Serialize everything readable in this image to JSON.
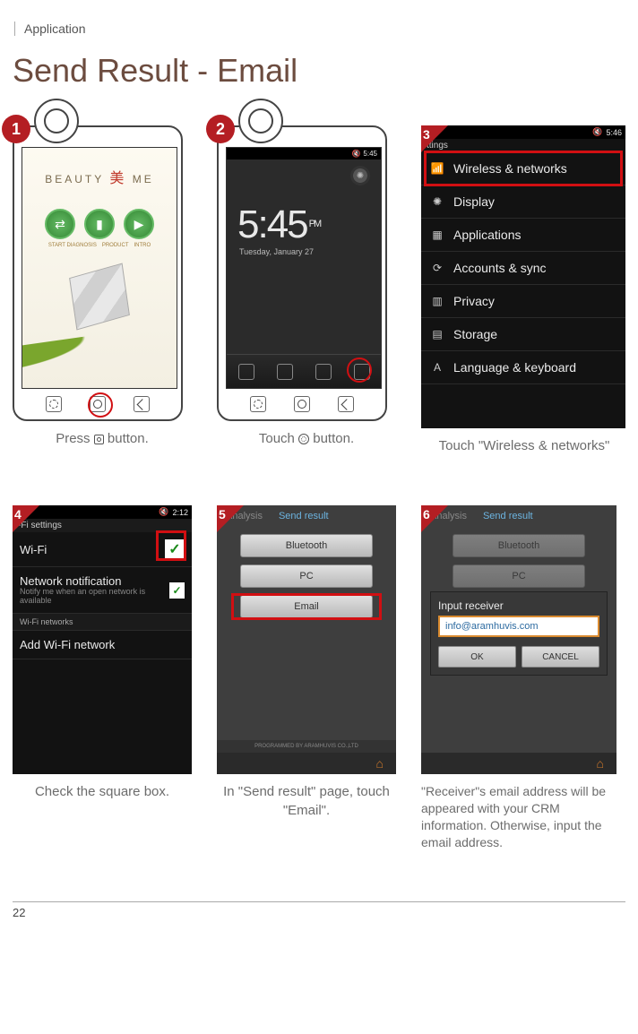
{
  "breadcrumb": "Application",
  "title": "Send Result - Email",
  "page_number": "22",
  "badges": {
    "s1": "1",
    "s2": "2",
    "s3": "3",
    "s4": "4",
    "s5": "5",
    "s6": "6"
  },
  "step1": {
    "logo_text": "BEAUTY",
    "logo_char": "美",
    "logo_suffix": "ME",
    "labels": {
      "a": "START DIAGNOSIS",
      "b": "PRODUCT",
      "c": "INTRO"
    },
    "caption_pre": "Press",
    "caption_post": "button."
  },
  "step2": {
    "status_time": "5:45",
    "time": {
      "hh": "5:45",
      "suffix": "PM"
    },
    "date": "Tuesday, January 27",
    "caption_pre": "Touch",
    "caption_post": "button."
  },
  "step3": {
    "status_time": "5:46",
    "header": "ttings",
    "items": {
      "wireless": "Wireless & networks",
      "display": "Display",
      "applications": "Applications",
      "accounts": "Accounts & sync",
      "privacy": "Privacy",
      "storage": "Storage",
      "language": "Language & keyboard"
    },
    "caption": "Touch \"Wireless & networks\""
  },
  "step4": {
    "status_time": "2:12",
    "header": "-Fi settings",
    "wifi_label": "Wi-Fi",
    "notif_title": "Network notification",
    "notif_sub": "Notify me when an open network is available",
    "section": "Wi-Fi networks",
    "addwifi": "Add Wi-Fi network",
    "caption": "Check the square box."
  },
  "step5": {
    "tabs": {
      "analysis": "Analysis",
      "send": "Send result"
    },
    "buttons": {
      "bt": "Bluetooth",
      "pc": "PC",
      "email": "Email"
    },
    "footer": "PROGRAMMED BY ARAMHUVIS CO.,LTD",
    "caption": "In \"Send result\" page, touch \"Email\"."
  },
  "step6": {
    "tabs": {
      "analysis": "Analysis",
      "send": "Send result"
    },
    "buttons": {
      "bt": "Bluetooth",
      "pc": "PC"
    },
    "popup": {
      "label": "Input receiver",
      "value": "info@aramhuvis.com",
      "ok": "OK",
      "cancel": "CANCEL"
    },
    "caption": "\"Receiver\"s email address will be appeared with your CRM information. Otherwise, input the email address."
  }
}
